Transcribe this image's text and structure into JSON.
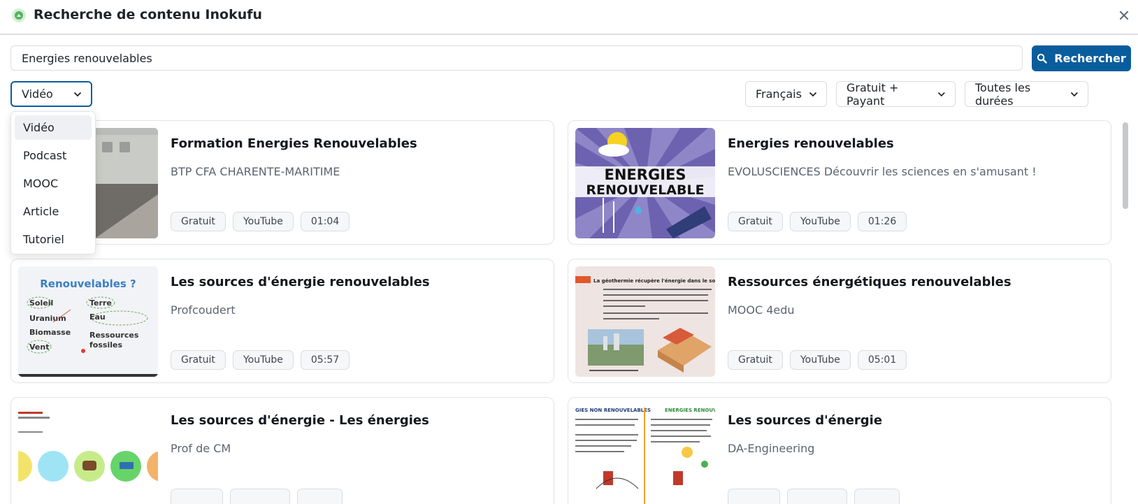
{
  "header": {
    "title": "Recherche de contenu Inokufu"
  },
  "search": {
    "value": "Energies renouvelables",
    "button_label": "Rechercher"
  },
  "filters": {
    "type": {
      "selected": "Vidéo",
      "options": [
        "Vidéo",
        "Podcast",
        "MOOC",
        "Article",
        "Tutoriel"
      ]
    },
    "language": "Français",
    "price": "Gratuit + Payant",
    "duration": "Toutes les durées"
  },
  "results": [
    {
      "title": "Formation Energies Renouvelables",
      "source": "BTP CFA CHARENTE-MARITIME",
      "tags": [
        "Gratuit",
        "YouTube",
        "01:04"
      ]
    },
    {
      "title": "Energies renouvelables",
      "source": "EVOLUSCIENCES Découvrir les sciences en s'amusant !",
      "tags": [
        "Gratuit",
        "YouTube",
        "01:26"
      ],
      "thumb_text": [
        "ENERGIES",
        "RENOUVELABLE"
      ]
    },
    {
      "title": "Les sources d'énergie renouvelables",
      "source": "Profcoudert",
      "tags": [
        "Gratuit",
        "YouTube",
        "05:57"
      ],
      "thumb_text": [
        "Renouvelables ?",
        "Soleil",
        "Terre",
        "Uranium",
        "Eau",
        "Biomasse",
        "Ressources",
        "fossiles",
        "Vent"
      ]
    },
    {
      "title": "Ressources énergétiques renouvelables",
      "source": "MOOC 4edu",
      "tags": [
        "Gratuit",
        "YouTube",
        "05:01"
      ],
      "thumb_text": [
        "La géothermie récupère l'énergie dans le sol :"
      ]
    },
    {
      "title": "Les sources d'énergie - Les énergies",
      "source": "Prof de CM",
      "tags": [
        "",
        "",
        ""
      ]
    },
    {
      "title": "Les sources d'énergie",
      "source": "DA-Engineering",
      "tags": [
        "",
        "",
        ""
      ],
      "thumb_text": [
        "GIES NON RENOUVELABLES",
        "ENERGIES RENOUVELA"
      ]
    }
  ],
  "colors": {
    "primary": "#0a5d9c",
    "border": "#dcdfe3",
    "tag_bg": "#f6f7f9"
  },
  "icons": {
    "logo": "inokufu-logo-icon",
    "close": "close-icon",
    "search": "search-icon",
    "chevron": "chevron-down-icon"
  }
}
